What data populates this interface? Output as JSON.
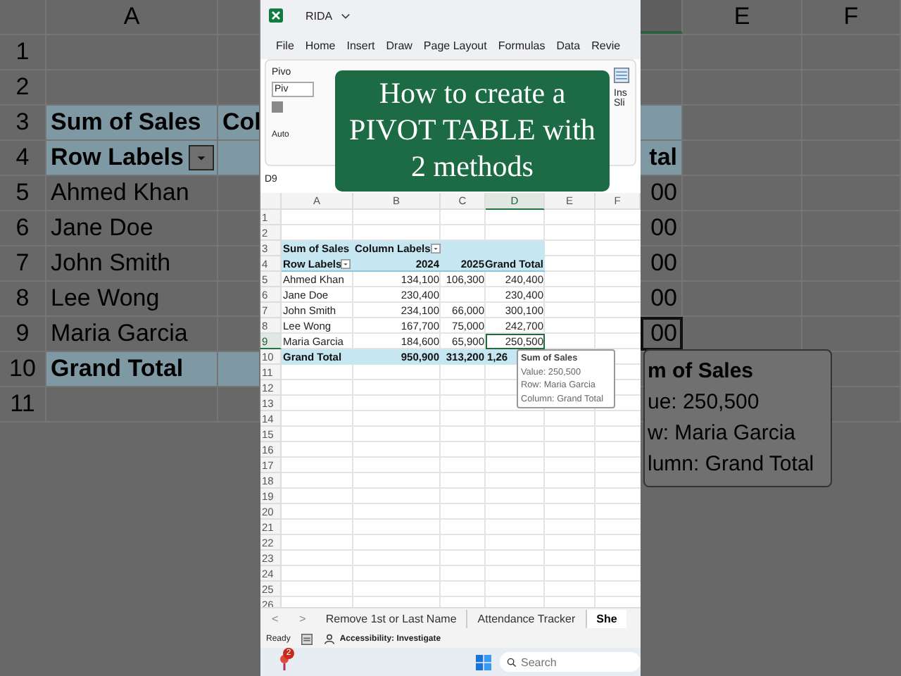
{
  "background_left": {
    "column_header": "A",
    "rows": [
      {
        "number": "1",
        "kind": "blank"
      },
      {
        "number": "2",
        "kind": "blank"
      },
      {
        "number": "3",
        "kind": "title",
        "a": "Sum of Sales",
        "b": "Col"
      },
      {
        "number": "4",
        "kind": "header",
        "a": "Row Labels"
      },
      {
        "number": "5",
        "kind": "item",
        "a": "Ahmed Khan"
      },
      {
        "number": "6",
        "kind": "item",
        "a": "Jane Doe"
      },
      {
        "number": "7",
        "kind": "item",
        "a": "John Smith"
      },
      {
        "number": "8",
        "kind": "item",
        "a": "Lee Wong"
      },
      {
        "number": "9",
        "kind": "item",
        "a": "Maria Garcia"
      },
      {
        "number": "10",
        "kind": "total",
        "a": "Grand Total"
      },
      {
        "number": "11",
        "kind": "blank"
      }
    ]
  },
  "excel": {
    "title_bar": {
      "title": "RIDA"
    },
    "menu": [
      "File",
      "Home",
      "Insert",
      "Draw",
      "Page Layout",
      "Formulas",
      "Data",
      "Revie"
    ],
    "ribbon": {
      "name_label": "Pivo",
      "name_field": "Piv",
      "footer_label": "Auto",
      "right_button_lines": [
        "Ins",
        "Sli"
      ]
    },
    "overlay_caption": "How to create a\nPIVOT TABLE with\n2 methods",
    "name_box": "D9",
    "column_headers": [
      "A",
      "B",
      "C",
      "D",
      "E",
      "F"
    ],
    "rows": [
      {
        "number": "1",
        "kind": "blank",
        "selected": false
      },
      {
        "number": "2",
        "kind": "blank",
        "selected": false
      },
      {
        "number": "3",
        "kind": "title",
        "a": "Sum of Sales",
        "b": "Column Labels",
        "selected": false
      },
      {
        "number": "4",
        "kind": "header",
        "a": "Row Labels",
        "b": "2024",
        "c": "2025",
        "d": "Grand Total",
        "selected": false
      },
      {
        "number": "5",
        "kind": "item",
        "a": "Ahmed Khan",
        "b": "134,100",
        "c": "106,300",
        "d": "240,400",
        "selected": false
      },
      {
        "number": "6",
        "kind": "item",
        "a": "Jane Doe",
        "b": "230,400",
        "d": "230,400",
        "selected": false
      },
      {
        "number": "7",
        "kind": "item",
        "a": "John Smith",
        "b": "234,100",
        "c": "66,000",
        "d": "300,100",
        "selected": false
      },
      {
        "number": "8",
        "kind": "item",
        "a": "Lee Wong",
        "b": "167,700",
        "c": "75,000",
        "d": "242,700",
        "selected": false
      },
      {
        "number": "9",
        "kind": "item",
        "a": "Maria Garcia",
        "b": "184,600",
        "c": "65,900",
        "d": "250,500",
        "selected": true
      },
      {
        "number": "10",
        "kind": "total",
        "a": "Grand Total",
        "b": "950,900",
        "c": "313,200",
        "d": "1,26",
        "selected": false
      },
      {
        "number": "11",
        "kind": "blank",
        "selected": false
      },
      {
        "number": "12",
        "kind": "blank",
        "selected": false
      },
      {
        "number": "13",
        "kind": "blank",
        "selected": false
      },
      {
        "number": "14",
        "kind": "blank",
        "selected": false
      },
      {
        "number": "15",
        "kind": "blank",
        "selected": false
      },
      {
        "number": "16",
        "kind": "blank",
        "selected": false
      },
      {
        "number": "17",
        "kind": "blank",
        "selected": false
      },
      {
        "number": "18",
        "kind": "blank",
        "selected": false
      },
      {
        "number": "19",
        "kind": "blank",
        "selected": false
      },
      {
        "number": "20",
        "kind": "blank",
        "selected": false
      },
      {
        "number": "21",
        "kind": "blank",
        "selected": false
      },
      {
        "number": "22",
        "kind": "blank",
        "selected": false
      },
      {
        "number": "23",
        "kind": "blank",
        "selected": false
      },
      {
        "number": "24",
        "kind": "blank",
        "selected": false
      },
      {
        "number": "25",
        "kind": "blank",
        "selected": false
      },
      {
        "number": "26",
        "kind": "blank",
        "selected": false
      }
    ],
    "tooltip": {
      "title": "Sum of Sales",
      "lines": [
        "Value: 250,500",
        "Row: Maria Garcia",
        "Column: Grand Total"
      ]
    },
    "sheet_nav": [
      "<",
      ">"
    ],
    "sheet_tabs": [
      {
        "label": "Remove 1st or Last Name",
        "selected": false
      },
      {
        "label": "Attendance Tracker",
        "selected": false
      },
      {
        "label": "She",
        "selected": true
      }
    ],
    "status_bar": {
      "status": "Ready",
      "accessibility": "Accessibility: Investigate"
    },
    "taskbar": {
      "badge": "2",
      "search": {
        "placeholder": "Search"
      }
    }
  },
  "background_right": {
    "column_headers": [
      "E",
      "F"
    ],
    "rows": [
      {
        "kind": "blank",
        "selected": false
      },
      {
        "kind": "blank",
        "selected": false
      },
      {
        "kind": "title",
        "selected": false
      },
      {
        "kind": "header",
        "d": "tal",
        "selected": false
      },
      {
        "kind": "item",
        "d": "00",
        "selected": false
      },
      {
        "kind": "item",
        "d": "00",
        "selected": false
      },
      {
        "kind": "item",
        "d": "00",
        "selected": false
      },
      {
        "kind": "item",
        "d": "00",
        "selected": false
      },
      {
        "kind": "item",
        "d": "00",
        "selected": true
      },
      {
        "kind": "blank",
        "selected": false
      },
      {
        "kind": "blank",
        "selected": false
      }
    ],
    "tooltip": {
      "title": "m of Sales",
      "lines": [
        "ue: 250,500",
        "w: Maria Garcia",
        "lumn: Grand Total"
      ]
    }
  }
}
